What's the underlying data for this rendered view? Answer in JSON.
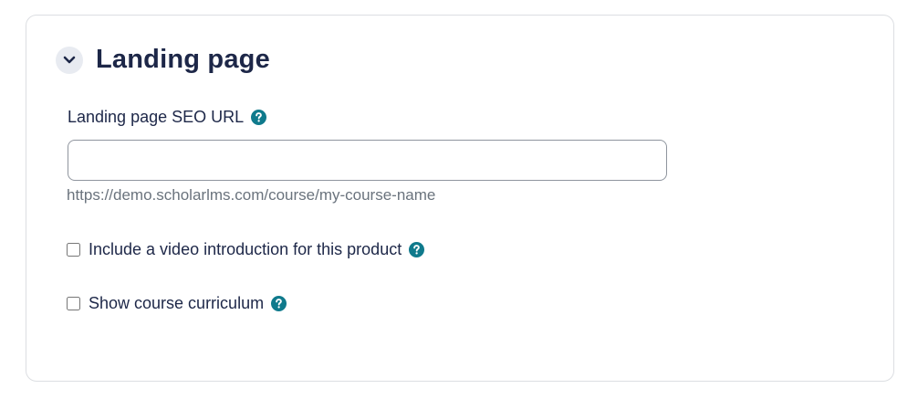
{
  "section": {
    "title": "Landing page",
    "toggle_icon": "chevron-down-icon"
  },
  "seo_url": {
    "label": "Landing page SEO URL",
    "value": "",
    "placeholder": "",
    "hint": "https://demo.scholarlms.com/course/my-course-name",
    "help_icon": "question-circle-icon"
  },
  "options": [
    {
      "label": "Include a video introduction for this product",
      "checked": false,
      "help_icon": "question-circle-icon"
    },
    {
      "label": "Show course curriculum",
      "checked": false,
      "help_icon": "question-circle-icon"
    }
  ],
  "colors": {
    "heading": "#1d2748",
    "help_icon": "#0f7a8c",
    "hint_text": "#6a737d",
    "toggle_bg": "#e8ebf1",
    "card_border": "#dcdee2"
  }
}
